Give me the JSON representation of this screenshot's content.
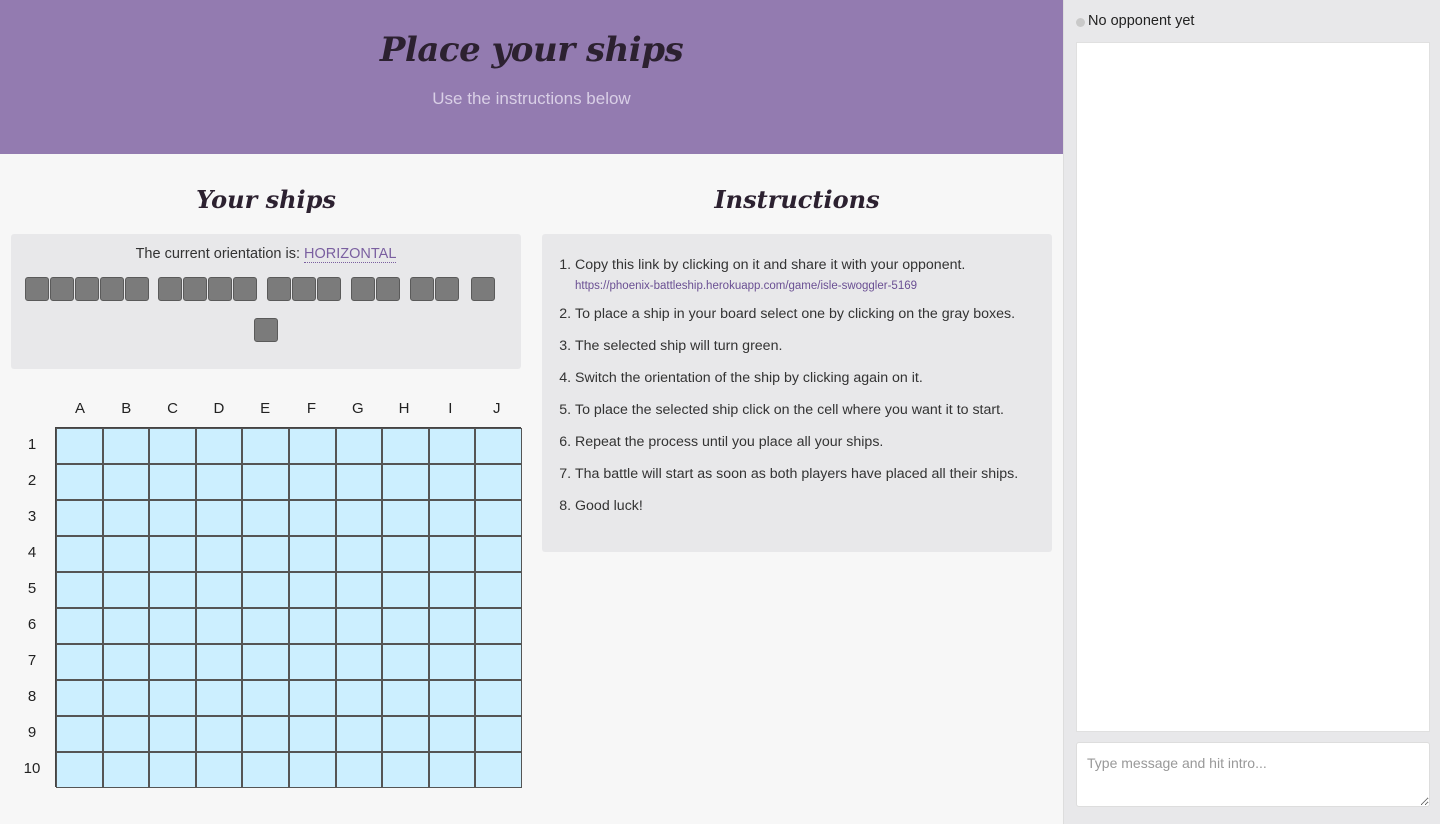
{
  "header": {
    "title": "Place your ships",
    "subtitle": "Use the instructions below"
  },
  "ships_section": {
    "title": "Your ships",
    "orientation_label": "The current orientation is:",
    "orientation_value": "HORIZONTAL",
    "ships": [
      5,
      4,
      3,
      2,
      2,
      1,
      1
    ]
  },
  "board": {
    "columns": [
      "A",
      "B",
      "C",
      "D",
      "E",
      "F",
      "G",
      "H",
      "I",
      "J"
    ],
    "rows": [
      "1",
      "2",
      "3",
      "4",
      "5",
      "6",
      "7",
      "8",
      "9",
      "10"
    ]
  },
  "instructions": {
    "title": "Instructions",
    "steps": [
      "Copy this link by clicking on it and share it with your opponent.",
      "To place a ship in your board select one by clicking on the gray boxes.",
      "The selected ship will turn green.",
      "Switch the orientation of the ship by clicking again on it.",
      "To place the selected ship click on the cell where you want it to start.",
      "Repeat the process until you place all your ships.",
      "Tha battle will start as soon as both players have placed all their ships.",
      "Good luck!"
    ],
    "share_link": "https://phoenix-battleship.herokuapp.com/game/isle-swoggler-5169"
  },
  "chat": {
    "status": "No opponent yet",
    "placeholder": "Type message and hit intro..."
  },
  "colors": {
    "header_bg": "#937bb0",
    "cell_bg": "#ccefff",
    "ship_gray": "#7b7b7b",
    "accent": "#7a5fa0"
  }
}
